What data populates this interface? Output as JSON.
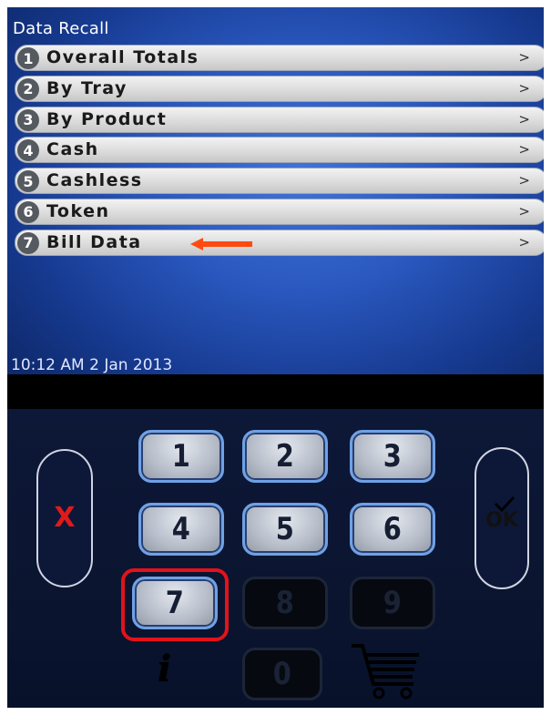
{
  "screen": {
    "title": "Data Recall",
    "datetime": "10:12 AM 2 Jan 2013"
  },
  "menu": {
    "chevron": ">",
    "items": [
      {
        "number": "1",
        "label": "Overall Totals"
      },
      {
        "number": "2",
        "label": "By Tray"
      },
      {
        "number": "3",
        "label": "By Product"
      },
      {
        "number": "4",
        "label": "Cash"
      },
      {
        "number": "5",
        "label": "Cashless"
      },
      {
        "number": "6",
        "label": "Token"
      },
      {
        "number": "7",
        "label": "Bill Data"
      }
    ]
  },
  "keypad": {
    "cancel_label": "X",
    "ok_label": "OK",
    "keys": [
      "1",
      "2",
      "3",
      "4",
      "5",
      "6",
      "7",
      "8",
      "9",
      "0"
    ],
    "enabled_keys": [
      "1",
      "2",
      "3",
      "4",
      "5",
      "6",
      "7"
    ],
    "disabled_keys": [
      "8",
      "9",
      "0"
    ],
    "highlighted_key": "7",
    "info_icon": "info-icon",
    "cart_icon": "cart-icon"
  },
  "colors": {
    "screen_blue": "#2a58bf",
    "annotation_red": "#e3121b",
    "callout_arrow": "#ff4a10",
    "cancel_red": "#e01a1a"
  }
}
